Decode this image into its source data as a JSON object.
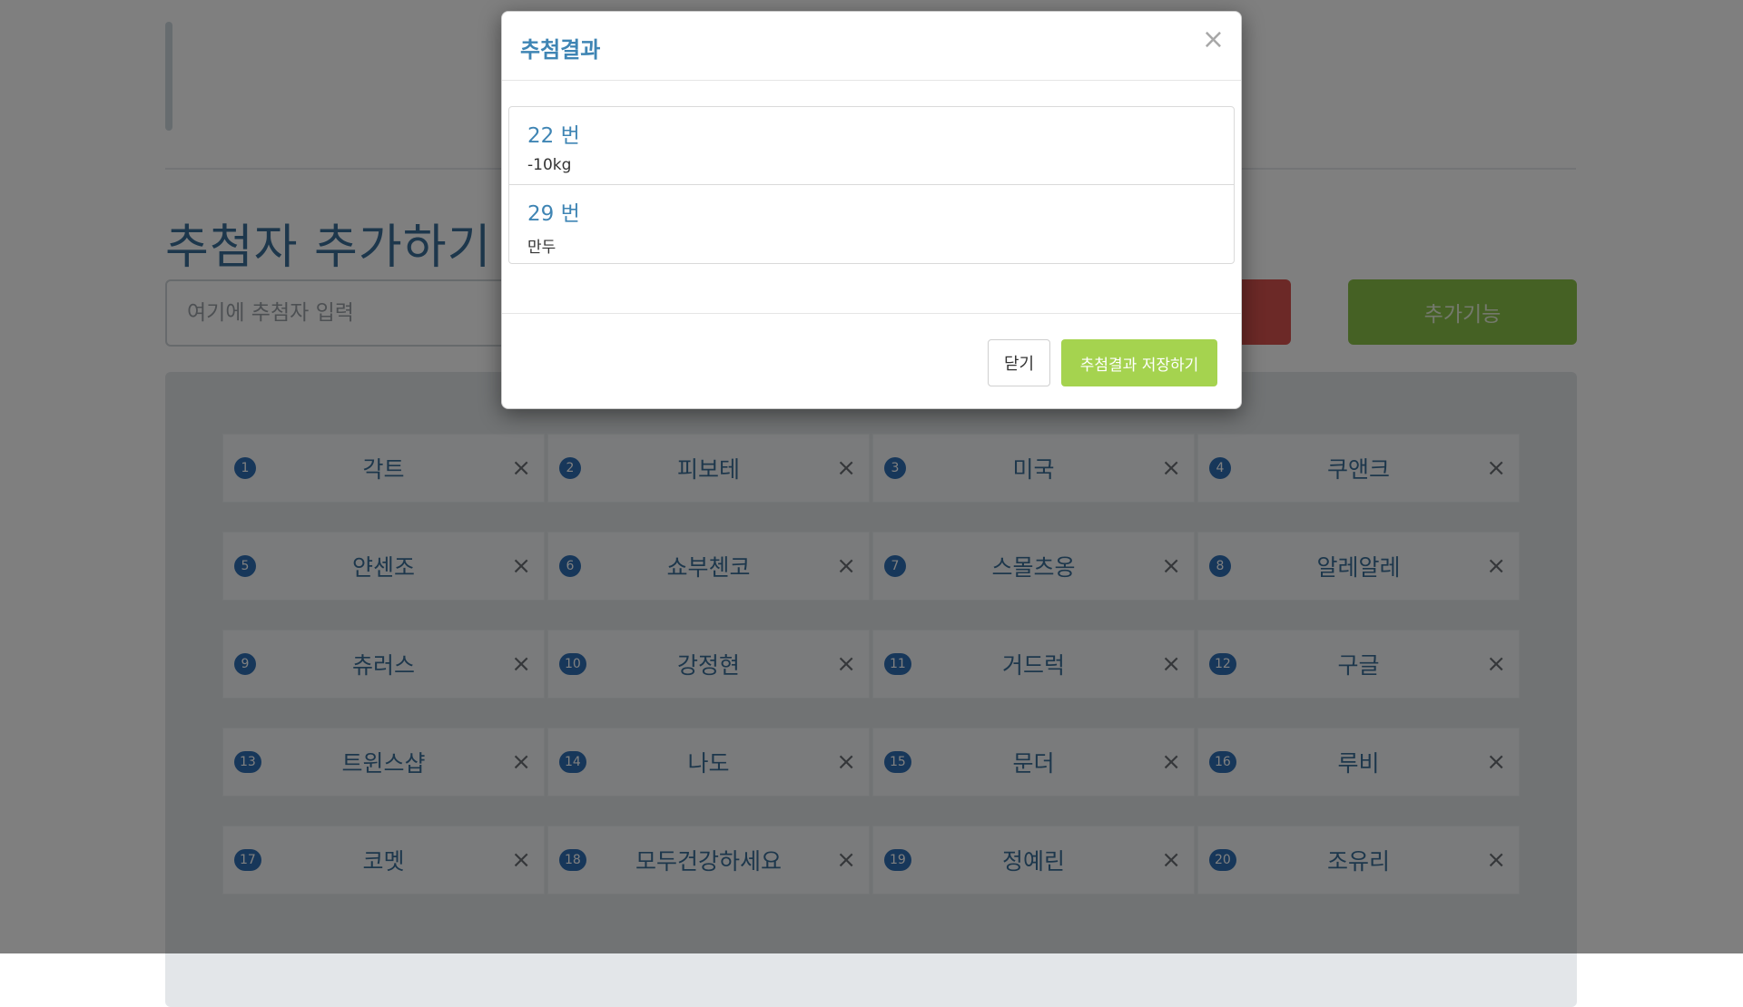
{
  "page": {
    "section_title": "추첨자 추가하기",
    "input_placeholder": "여기에 추첨자 입력",
    "extra_button_label": "추가기능",
    "participants": [
      {
        "num": "1",
        "name": "각트"
      },
      {
        "num": "2",
        "name": "피보테"
      },
      {
        "num": "3",
        "name": "미국"
      },
      {
        "num": "4",
        "name": "쿠앤크"
      },
      {
        "num": "5",
        "name": "얀센조"
      },
      {
        "num": "6",
        "name": "쇼부첸코"
      },
      {
        "num": "7",
        "name": "스몰츠옹"
      },
      {
        "num": "8",
        "name": "알레알레"
      },
      {
        "num": "9",
        "name": "츄러스"
      },
      {
        "num": "10",
        "name": "강정현"
      },
      {
        "num": "11",
        "name": "거드럭"
      },
      {
        "num": "12",
        "name": "구글"
      },
      {
        "num": "13",
        "name": "트윈스샵"
      },
      {
        "num": "14",
        "name": "나도"
      },
      {
        "num": "15",
        "name": "문더"
      },
      {
        "num": "16",
        "name": "루비"
      },
      {
        "num": "17",
        "name": "코멧"
      },
      {
        "num": "18",
        "name": "모두건강하세요"
      },
      {
        "num": "19",
        "name": "정예린"
      },
      {
        "num": "20",
        "name": "조유리"
      }
    ],
    "delete_glyph": "×"
  },
  "modal": {
    "title": "추첨결과",
    "close_glyph": "×",
    "results": [
      {
        "num_label": "22 번",
        "name": "-10kg"
      },
      {
        "num_label": "29 번",
        "name": "만두"
      }
    ],
    "close_button_label": "닫기",
    "save_button_label": "추첨결과 저장하기"
  },
  "colors": {
    "accent_blue": "#3f85b4",
    "save_green": "#a5d34f",
    "extra_green": "#8ac249",
    "danger_red": "#d9534f",
    "badge_blue": "#2f6fb5"
  }
}
